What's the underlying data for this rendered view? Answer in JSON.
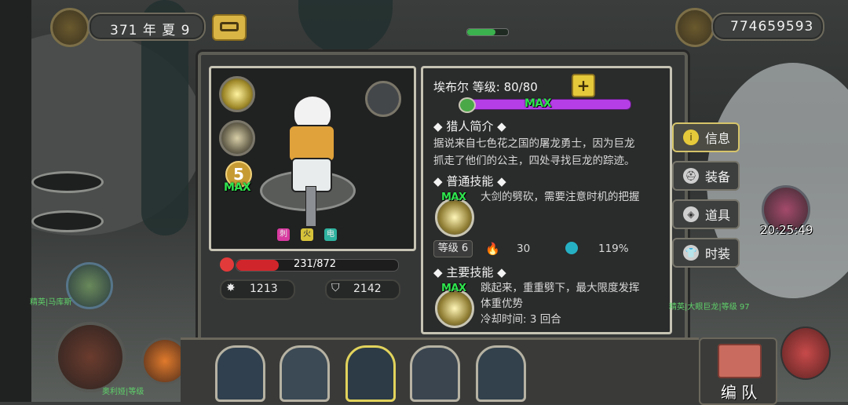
{
  "hud": {
    "date": "371 年 夏 9",
    "currency": "774659593",
    "timer": "20:25:49",
    "moon_icon": "moon-icon",
    "coin_icon": "coin-icon",
    "menu_icon": "menu-icon"
  },
  "hero": {
    "name_level": "埃布尔  等级: 80/80",
    "exp_label": "MAX",
    "star_level": "5",
    "star_label": "MAX",
    "hp": "231/872",
    "hp_fraction": 0.26,
    "attack": "1213",
    "defense": "2142",
    "element_badges": [
      "刺",
      "火",
      "电"
    ]
  },
  "intro": {
    "title": "猎人简介",
    "text_line1": "据说来自七色花之国的屠龙勇士，因为巨龙",
    "text_line2": "抓走了他们的公主，四处寻找巨龙的踪迹。"
  },
  "normal_skill": {
    "title": "普通技能",
    "max": "MAX",
    "text": "大剑的劈砍，需要注意时机的把握",
    "level": "等级 6",
    "stat1": "30",
    "stat2": "119%"
  },
  "main_skill": {
    "title": "主要技能",
    "max": "MAX",
    "text_line1": "跳起来，重重劈下，最大限度发挥",
    "text_line2": "体重优势",
    "cooldown": "冷却时间: 3 回合"
  },
  "side_tabs": [
    "信息",
    "装备",
    "道具",
    "时装"
  ],
  "team_button": "编 队",
  "map_labels": {
    "left": "精英|马库斯",
    "left_bottom": "奥利娅|等级",
    "right": "精英|大眼巨龙|等级 97"
  },
  "colors": {
    "accent_gold": "#e2c94a",
    "hp_red": "#d0262b",
    "exp_purple": "#b53ee6",
    "max_green": "#2fe34e"
  }
}
